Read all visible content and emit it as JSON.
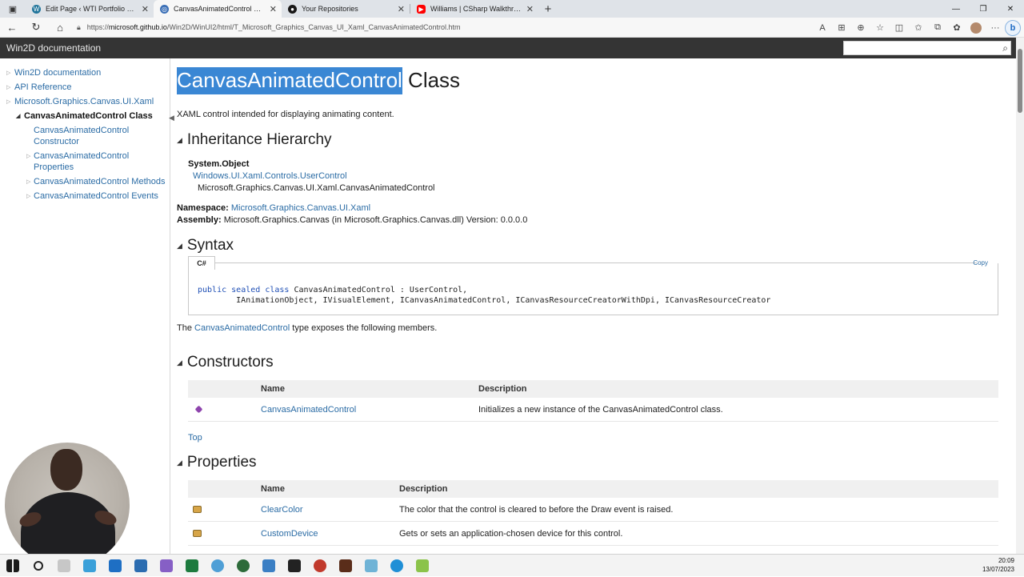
{
  "browser": {
    "tabs": [
      {
        "label": "Edit Page ‹ WTI Portfolio — Wo...",
        "icon": "wordpress-icon",
        "color": "#21759b",
        "active": false
      },
      {
        "label": "CanvasAnimatedControl Class",
        "icon": "globe-icon",
        "color": "#3b6fb6",
        "active": true
      },
      {
        "label": "Your Repositories",
        "icon": "github-icon",
        "color": "#181717",
        "active": false
      },
      {
        "label": "Williams | CSharp Walkthroughs",
        "icon": "youtube-icon",
        "color": "#ff0000",
        "active": false
      }
    ],
    "close_glyph": "✕",
    "new_tab_glyph": "+",
    "url_prefix": "https://",
    "url_host": "microsoft.github.io",
    "url_path": "/Win2D/WinUI2/html/T_Microsoft_Graphics_Canvas_UI_Xaml_CanvasAnimatedControl.htm"
  },
  "header": {
    "title": "Win2D documentation",
    "search_value": ""
  },
  "sidebar": {
    "items": [
      {
        "label": "Win2D documentation"
      },
      {
        "label": "API Reference"
      },
      {
        "label": "Microsoft.Graphics.Canvas.UI.Xaml"
      }
    ],
    "current": "CanvasAnimatedControl Class",
    "children": [
      {
        "label": "CanvasAnimatedControl Constructor",
        "expandable": false
      },
      {
        "label": "CanvasAnimatedControl Properties",
        "expandable": true
      },
      {
        "label": "CanvasAnimatedControl Methods",
        "expandable": true
      },
      {
        "label": "CanvasAnimatedControl Events",
        "expandable": true
      }
    ]
  },
  "page": {
    "title_highlight": "CanvasAnimatedControl",
    "title_rest": " Class",
    "summary": "XAML control intended for displaying animating content.",
    "sections": {
      "inheritance": "Inheritance Hierarchy",
      "syntax": "Syntax",
      "constructors": "Constructors",
      "properties": "Properties"
    },
    "inheritance": {
      "root": "System.Object",
      "parent": "Windows.UI.Xaml.Controls.UserControl",
      "self": "Microsoft.Graphics.Canvas.UI.Xaml.CanvasAnimatedControl"
    },
    "namespace_label": "Namespace:",
    "namespace_value": "Microsoft.Graphics.Canvas.UI.Xaml",
    "assembly_label": "Assembly:",
    "assembly_value": "Microsoft.Graphics.Canvas (in Microsoft.Graphics.Canvas.dll) Version: 0.0.0.0",
    "code_tab": "C#",
    "copy_label": "Copy",
    "code": {
      "kw1": "public",
      "kw2": "sealed",
      "kw3": "class",
      "line1_rest": " CanvasAnimatedControl : UserControl,",
      "line2": "        IAnimationObject, IVisualElement, ICanvasAnimatedControl, ICanvasResourceCreatorWithDpi, ICanvasResourceCreator"
    },
    "members_pre": "The ",
    "members_link": "CanvasAnimatedControl",
    "members_post": " type exposes the following members.",
    "constructors_table": {
      "col_name": "Name",
      "col_desc": "Description",
      "rows": [
        {
          "name": "CanvasAnimatedControl",
          "description": "Initializes a new instance of the CanvasAnimatedControl class."
        }
      ]
    },
    "top_link": "Top",
    "properties_table": {
      "col_name": "Name",
      "col_desc": "Description",
      "rows": [
        {
          "name": "ClearColor",
          "description": "The color that the control is cleared to before the Draw event is raised."
        },
        {
          "name": "CustomDevice",
          "description": "Gets or sets an application-chosen device for this control."
        }
      ]
    }
  },
  "taskbar": {
    "time": "20:09",
    "date": "13/07/2023"
  }
}
